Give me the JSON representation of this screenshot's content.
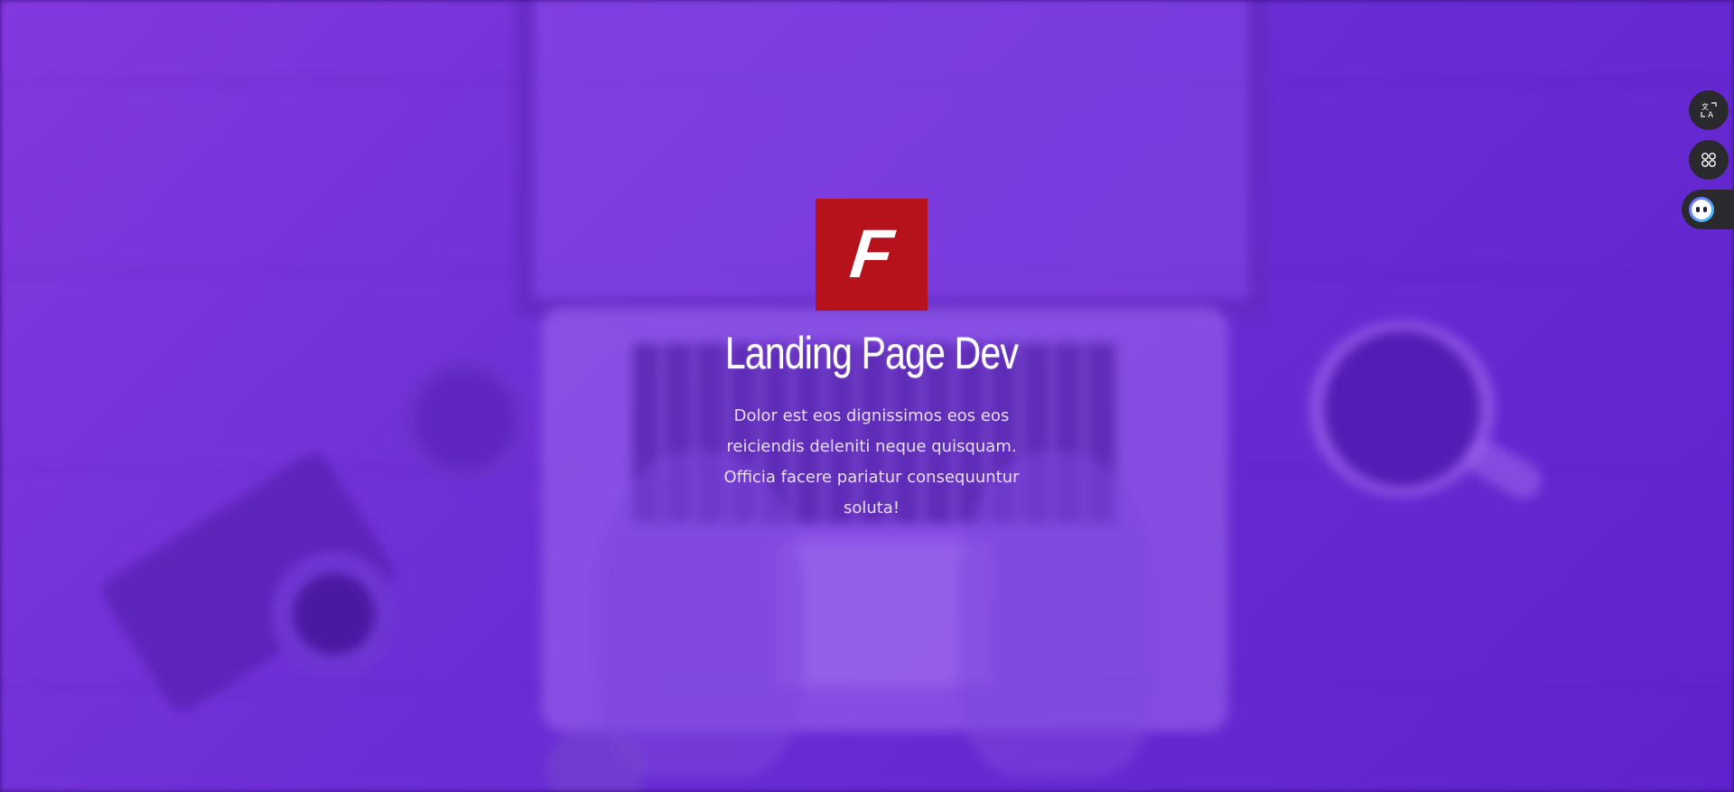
{
  "hero": {
    "title": "Landing Page Dev",
    "description": "Dolor est eos dignissimos eos eos reiciendis deleniti neque quisquam. Officia facere pariatur consequuntur soluta!",
    "logo": {
      "letter": "F",
      "color": "#b5121b"
    },
    "overlay_color": "#6a30d4"
  },
  "side_tools": [
    {
      "icon": "translate-icon"
    },
    {
      "icon": "apps-grid-icon"
    },
    {
      "icon": "assistant-icon"
    }
  ]
}
